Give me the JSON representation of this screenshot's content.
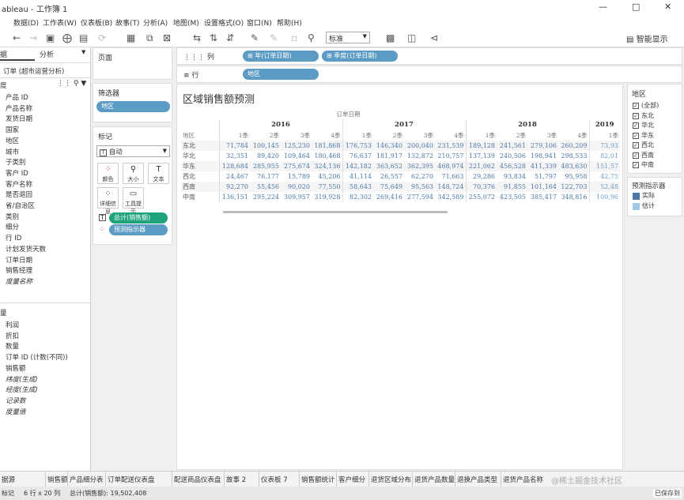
{
  "window": {
    "title": "ableau - 工作簿 1"
  },
  "menu": [
    "数据(D)",
    "工作表(W)",
    "仪表板(B)",
    "故事(T)",
    "分析(A)",
    "地图(M)",
    "设置格式(O)",
    "窗口(N)",
    "帮助(H)"
  ],
  "toolbar": {
    "fit_select": "标准",
    "smart_show": "智能显示"
  },
  "datapane": {
    "tab_data": "据",
    "tab_analytics": "分析",
    "datasource": "订单 (超市运营分析)",
    "dims_header": "度",
    "dimensions": [
      "产品 ID",
      "产品名称",
      "发货日期",
      "国家",
      "地区",
      "城市",
      "子类别",
      "客户 ID",
      "客户名称",
      "是否退回",
      "省/自治区",
      "类别",
      "细分",
      "行 ID",
      "计划发货天数",
      "订单日期",
      "销售经理",
      "度量名称"
    ],
    "measures_header": "量",
    "measures": [
      "利润",
      "折扣",
      "数量",
      "订单 ID (计数(不同))",
      "销售额",
      "纬度(生成)",
      "经度(生成)",
      "记录数",
      "度量值"
    ]
  },
  "shelves": {
    "pages": "页面",
    "filters": "筛选器",
    "filter_pill": "地区",
    "marks": "标记",
    "mark_type": "自动",
    "mark_buttons": [
      "颜色",
      "大小",
      "文本",
      "详细信息",
      "工具提示"
    ],
    "pill_sum": "总计(销售额)",
    "pill_forecast": "预测指示器",
    "columns_label": "列",
    "rows_label": "行",
    "col_pills": [
      "年(订单日期)",
      "季度(订单日期)"
    ],
    "row_pills": [
      "地区"
    ]
  },
  "view": {
    "title": "区域销售额预测",
    "header_top": "订单日期",
    "row_header": "地区",
    "years": [
      "2016",
      "2017",
      "2018",
      "2019"
    ],
    "quarters": [
      "1季",
      "2季",
      "3季",
      "4季"
    ],
    "rows": [
      {
        "region": "东北",
        "values": [
          "71,784",
          "100,145",
          "125,230",
          "181,868",
          "176,753",
          "146,340",
          "200,040",
          "231,539",
          "189,128",
          "241,561",
          "279,106",
          "260,209",
          "73,93"
        ]
      },
      {
        "region": "华北",
        "values": [
          "32,351",
          "89,420",
          "109,464",
          "180,468",
          "76,637",
          "181,917",
          "132,872",
          "210,757",
          "137,139",
          "240,506",
          "198,941",
          "298,533",
          "82,01"
        ]
      },
      {
        "region": "华东",
        "values": [
          "128,684",
          "285,955",
          "275,674",
          "324,136",
          "142,182",
          "363,652",
          "362,395",
          "468,974",
          "221,062",
          "456,528",
          "411,339",
          "483,630",
          "151,57"
        ]
      },
      {
        "region": "西北",
        "values": [
          "24,467",
          "76,177",
          "15,789",
          "45,206",
          "41,114",
          "26,557",
          "62,270",
          "71,663",
          "29,286",
          "93,834",
          "51,797",
          "95,958",
          "42,75"
        ]
      },
      {
        "region": "西南",
        "values": [
          "92,270",
          "55,456",
          "90,020",
          "77,550",
          "58,643",
          "75,649",
          "95,563",
          "148,724",
          "70,376",
          "91,855",
          "101,164",
          "122,703",
          "52,48"
        ]
      },
      {
        "region": "中南",
        "values": [
          "136,151",
          "295,224",
          "309,957",
          "319,928",
          "82,302",
          "269,416",
          "277,594",
          "342,589",
          "255,072",
          "423,505",
          "385,417",
          "348,816",
          "100,96"
        ]
      }
    ]
  },
  "filter_legend": {
    "title": "地区",
    "items": [
      "(全部)",
      "东北",
      "华北",
      "华东",
      "西北",
      "西南",
      "中南"
    ]
  },
  "forecast_legend": {
    "title": "预测指示器",
    "items": [
      {
        "label": "实际",
        "color": "#4e79a7"
      },
      {
        "label": "估计",
        "color": "#a0cbe8"
      }
    ]
  },
  "sheet_tabs": [
    "据源",
    "销售额",
    "产品细分表",
    "订单配送仪表盘",
    "配送商品仪表盘",
    "故事 2",
    "仪表板 7",
    "销售额统计",
    "客户细分",
    "退货区域分布",
    "退货产品数量",
    "退换产品类型",
    "退货产品名称",
    "@稀土掘金技术社区"
  ],
  "status": {
    "marks": "标记",
    "rows_cols": "6 行 x 20 列",
    "sum": "总计(销售额): 19,502,408",
    "saved": "已保存到"
  }
}
